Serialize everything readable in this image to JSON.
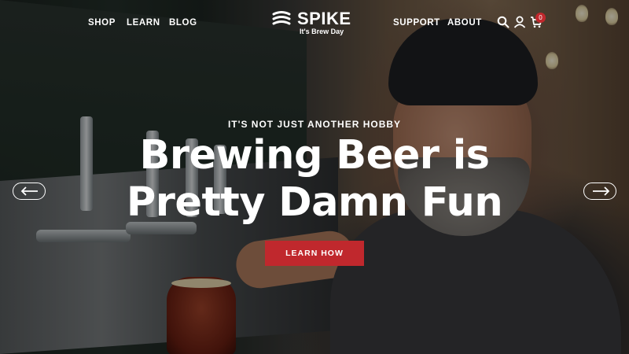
{
  "nav": {
    "left": [
      {
        "label": "SHOP"
      },
      {
        "label": "LEARN"
      },
      {
        "label": "BLOG"
      }
    ],
    "right": [
      {
        "label": "SUPPORT"
      },
      {
        "label": "ABOUT"
      }
    ]
  },
  "brand": {
    "name": "SPIKE",
    "tagline": "It's Brew Day",
    "logo_icon": "spike-wave-logo-icon"
  },
  "header_icons": {
    "search": "search-icon",
    "account": "user-icon",
    "cart": "cart-icon",
    "cart_count": "0"
  },
  "hero": {
    "eyebrow": "IT'S NOT JUST ANOTHER HOBBY",
    "headline_line1": "Brewing Beer is",
    "headline_line2": "Pretty Damn Fun",
    "cta_label": "LEARN HOW",
    "prev_icon": "arrow-left-icon",
    "next_icon": "arrow-right-icon"
  },
  "colors": {
    "accent": "#c0282d",
    "text": "#ffffff"
  }
}
